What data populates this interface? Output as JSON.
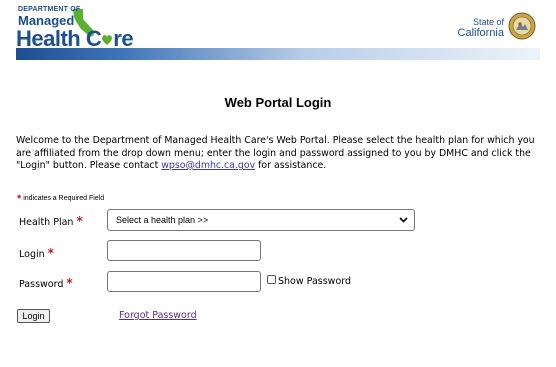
{
  "header": {
    "logo": {
      "line1": "DEPARTMENT OF",
      "line2": "Managed",
      "line3_part1": "Health",
      "line3_part2": "C",
      "line3_part3": "re"
    },
    "state_line1": "State of",
    "state_line2": "California"
  },
  "page": {
    "title": "Web Portal Login",
    "welcome_line1": "Welcome to the Department of Managed Health Care's Web Portal. Please select the health plan for which you",
    "welcome_line2": "are affiliated from the drop down menu; enter the login and password assigned to you by DMHC and click the",
    "welcome_line3_before": "\"Login\" button. Please contact ",
    "welcome_email": "wpso@dmhc.ca.gov",
    "welcome_line3_after": " for assistance."
  },
  "form": {
    "required_marker": "*",
    "required_note": "indicates a Required Field",
    "health_plan_label": "Health Plan",
    "health_plan_selected": "Select a health plan >>",
    "login_label": "Login",
    "login_value": "",
    "password_label": "Password",
    "password_value": "",
    "show_password_label": "Show Password",
    "show_password_checked": false,
    "login_button": "Login",
    "forgot_password": "Forgot Password"
  },
  "colors": {
    "brand_blue": "#1d4e8f",
    "brand_green": "#5cb030",
    "required_red": "#c0191e",
    "link_blue": "#3b3bb5",
    "visited_purple": "#5a2d8c"
  },
  "icons": {
    "select_arrow": "chevron-down-icon",
    "seal": "state-seal-icon",
    "state_outline": "california-outline-icon"
  }
}
